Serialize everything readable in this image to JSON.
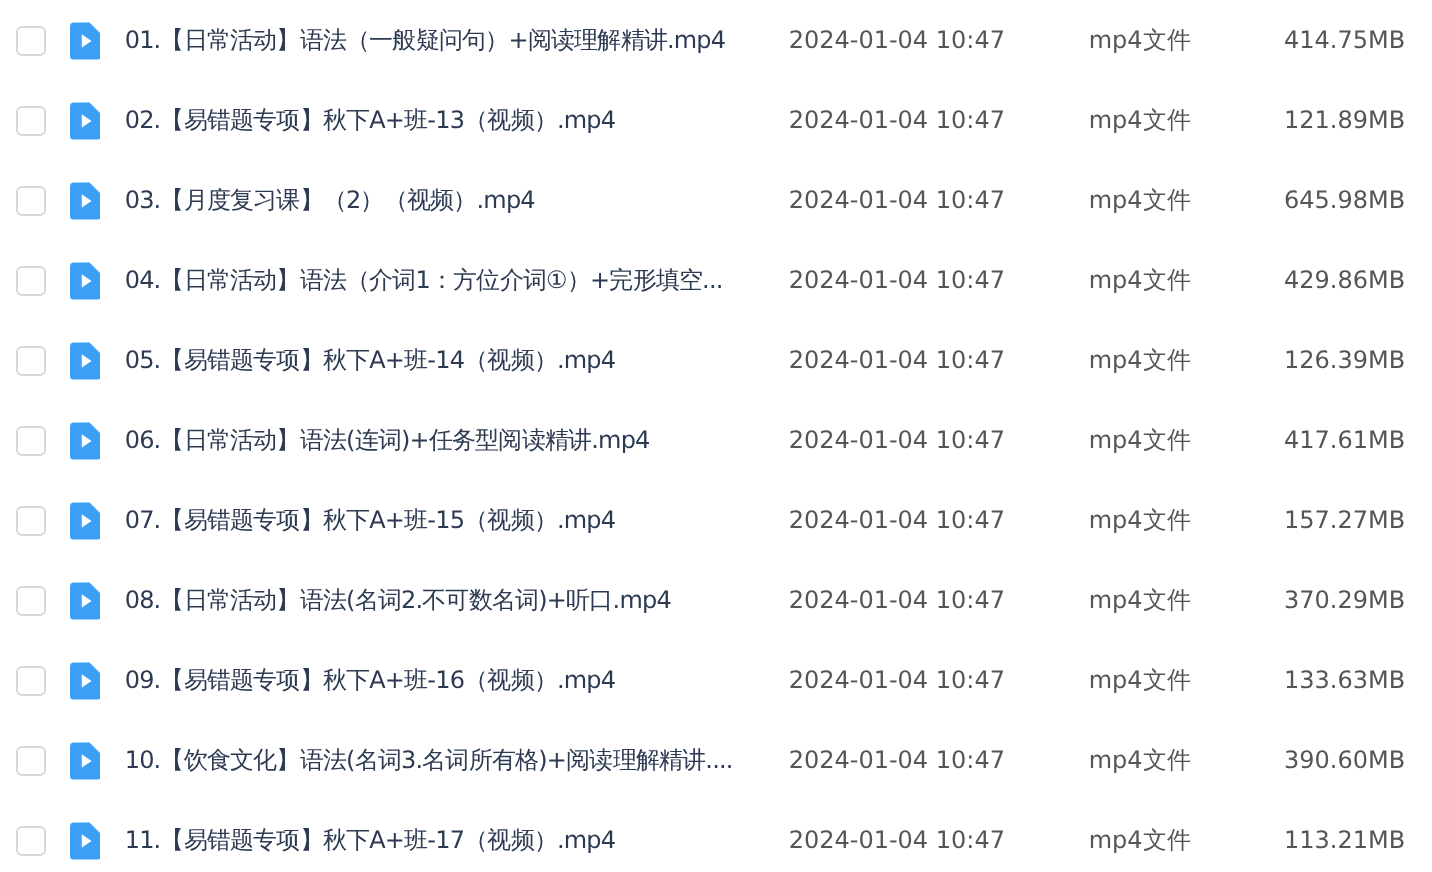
{
  "files": [
    {
      "name": "01.【日常活动】语法（一般疑问句）+阅读理解精讲.mp4",
      "date": "2024-01-04 10:47",
      "type": "mp4文件",
      "size": "414.75MB",
      "checked": false
    },
    {
      "name": "02.【易错题专项】秋下A+班-13（视频）.mp4",
      "date": "2024-01-04 10:47",
      "type": "mp4文件",
      "size": "121.89MB",
      "checked": false
    },
    {
      "name": "03.【月度复习课】（2）（视频）.mp4",
      "date": "2024-01-04 10:47",
      "type": "mp4文件",
      "size": "645.98MB",
      "checked": false
    },
    {
      "name": "04.【日常活动】语法（介词1：方位介词①）+完形填空...",
      "date": "2024-01-04 10:47",
      "type": "mp4文件",
      "size": "429.86MB",
      "checked": false
    },
    {
      "name": "05.【易错题专项】秋下A+班-14（视频）.mp4",
      "date": "2024-01-04 10:47",
      "type": "mp4文件",
      "size": "126.39MB",
      "checked": false
    },
    {
      "name": "06.【日常活动】语法(连词)+任务型阅读精讲.mp4",
      "date": "2024-01-04 10:47",
      "type": "mp4文件",
      "size": "417.61MB",
      "checked": false
    },
    {
      "name": "07.【易错题专项】秋下A+班-15（视频）.mp4",
      "date": "2024-01-04 10:47",
      "type": "mp4文件",
      "size": "157.27MB",
      "checked": false
    },
    {
      "name": "08.【日常活动】语法(名词2.不可数名词)+听口.mp4",
      "date": "2024-01-04 10:47",
      "type": "mp4文件",
      "size": "370.29MB",
      "checked": false
    },
    {
      "name": "09.【易错题专项】秋下A+班-16（视频）.mp4",
      "date": "2024-01-04 10:47",
      "type": "mp4文件",
      "size": "133.63MB",
      "checked": false
    },
    {
      "name": "10.【饮食文化】语法(名词3.名词所有格)+阅读理解精讲....",
      "date": "2024-01-04 10:47",
      "type": "mp4文件",
      "size": "390.60MB",
      "checked": false
    },
    {
      "name": "11.【易错题专项】秋下A+班-17（视频）.mp4",
      "date": "2024-01-04 10:47",
      "type": "mp4文件",
      "size": "113.21MB",
      "checked": false
    }
  ]
}
